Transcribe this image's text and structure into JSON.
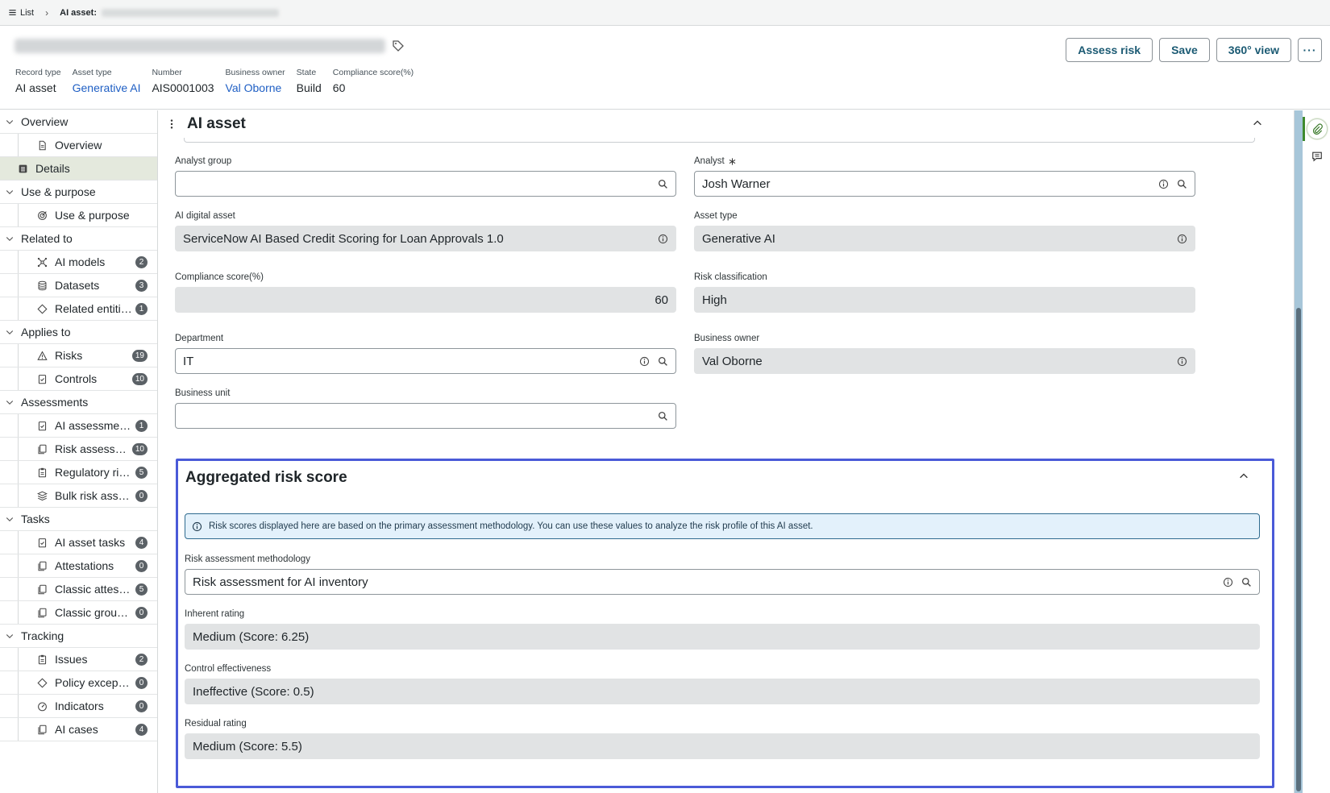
{
  "breadcrumb": {
    "list_label": "List",
    "current_label": "AI asset:"
  },
  "header": {
    "meta": [
      {
        "label": "Record type",
        "value": "AI asset",
        "link": false
      },
      {
        "label": "Asset type",
        "value": "Generative AI",
        "link": true
      },
      {
        "label": "Number",
        "value": "AIS0001003",
        "link": false
      },
      {
        "label": "Business owner",
        "value": "Val Oborne",
        "link": true
      },
      {
        "label": "State",
        "value": "Build",
        "link": false
      },
      {
        "label": "Compliance score(%)",
        "value": "60",
        "link": false
      }
    ],
    "actions": {
      "assess_risk": "Assess risk",
      "save": "Save",
      "view360": "360° view",
      "more": "···"
    }
  },
  "sidebar": {
    "groups": [
      {
        "label": "Overview",
        "items": [
          {
            "label": "Overview",
            "icon": "document-icon",
            "badge": ""
          }
        ]
      },
      {
        "label": "Details",
        "is_item": true,
        "icon": "list-icon",
        "active": true
      },
      {
        "label": "Use & purpose",
        "items": [
          {
            "label": "Use & purpose",
            "icon": "target-icon",
            "badge": ""
          }
        ]
      },
      {
        "label": "Related to",
        "items": [
          {
            "label": "AI models",
            "icon": "network-icon",
            "badge": "2"
          },
          {
            "label": "Datasets",
            "icon": "database-icon",
            "badge": "3"
          },
          {
            "label": "Related entities",
            "icon": "diamond-icon",
            "badge": "1"
          }
        ]
      },
      {
        "label": "Applies to",
        "items": [
          {
            "label": "Risks",
            "icon": "warning-icon",
            "badge": "19"
          },
          {
            "label": "Controls",
            "icon": "checklist-icon",
            "badge": "10"
          }
        ]
      },
      {
        "label": "Assessments",
        "items": [
          {
            "label": "AI assessments",
            "icon": "checklist-icon",
            "badge": "1"
          },
          {
            "label": "Risk assessm...",
            "icon": "copy-icon",
            "badge": "10"
          },
          {
            "label": "Regulatory ris...",
            "icon": "clipboard-icon",
            "badge": "5"
          },
          {
            "label": "Bulk risk asses...",
            "icon": "stack-icon",
            "badge": "0"
          }
        ]
      },
      {
        "label": "Tasks",
        "items": [
          {
            "label": "AI asset tasks",
            "icon": "checklist-icon",
            "badge": "4"
          },
          {
            "label": "Attestations",
            "icon": "copy-icon",
            "badge": "0"
          },
          {
            "label": "Classic attesta...",
            "icon": "copy-icon",
            "badge": "5"
          },
          {
            "label": "Classic groupe...",
            "icon": "copy-icon",
            "badge": "0"
          }
        ]
      },
      {
        "label": "Tracking",
        "items": [
          {
            "label": "Issues",
            "icon": "clipboard-icon",
            "badge": "2"
          },
          {
            "label": "Policy excepti...",
            "icon": "diamond-icon",
            "badge": "0"
          },
          {
            "label": "Indicators",
            "icon": "gauge-icon",
            "badge": "0"
          },
          {
            "label": "AI cases",
            "icon": "copy-icon",
            "badge": "4"
          }
        ]
      }
    ]
  },
  "ai_asset": {
    "title": "AI asset",
    "analyst_group": {
      "label": "Analyst group",
      "value": ""
    },
    "analyst": {
      "label": "Analyst",
      "value": "Josh Warner"
    },
    "ai_digital_asset": {
      "label": "AI digital asset",
      "value": "ServiceNow AI Based Credit Scoring for Loan Approvals 1.0"
    },
    "asset_type": {
      "label": "Asset type",
      "value": "Generative AI"
    },
    "compliance_score": {
      "label": "Compliance score(%)",
      "value": "60"
    },
    "risk_classification": {
      "label": "Risk classification",
      "value": "High"
    },
    "department": {
      "label": "Department",
      "value": "IT"
    },
    "business_owner": {
      "label": "Business owner",
      "value": "Val Oborne"
    },
    "business_unit": {
      "label": "Business unit",
      "value": ""
    }
  },
  "aggregated": {
    "title": "Aggregated risk score",
    "info": "Risk scores displayed here are based on the primary assessment methodology. You can use these values to analyze the risk profile of this AI asset.",
    "methodology": {
      "label": "Risk assessment methodology",
      "value": "Risk assessment for AI inventory"
    },
    "inherent": {
      "label": "Inherent rating",
      "value": "Medium (Score: 6.25)"
    },
    "control": {
      "label": "Control effectiveness",
      "value": "Ineffective (Score: 0.5)"
    },
    "residual": {
      "label": "Residual rating",
      "value": "Medium (Score: 5.5)"
    }
  },
  "colors": {
    "accent_link": "#1f5fc4",
    "button_text": "#1b5a73",
    "highlight_border": "#4a5ad8",
    "active_nav": "#e4e9dd"
  }
}
